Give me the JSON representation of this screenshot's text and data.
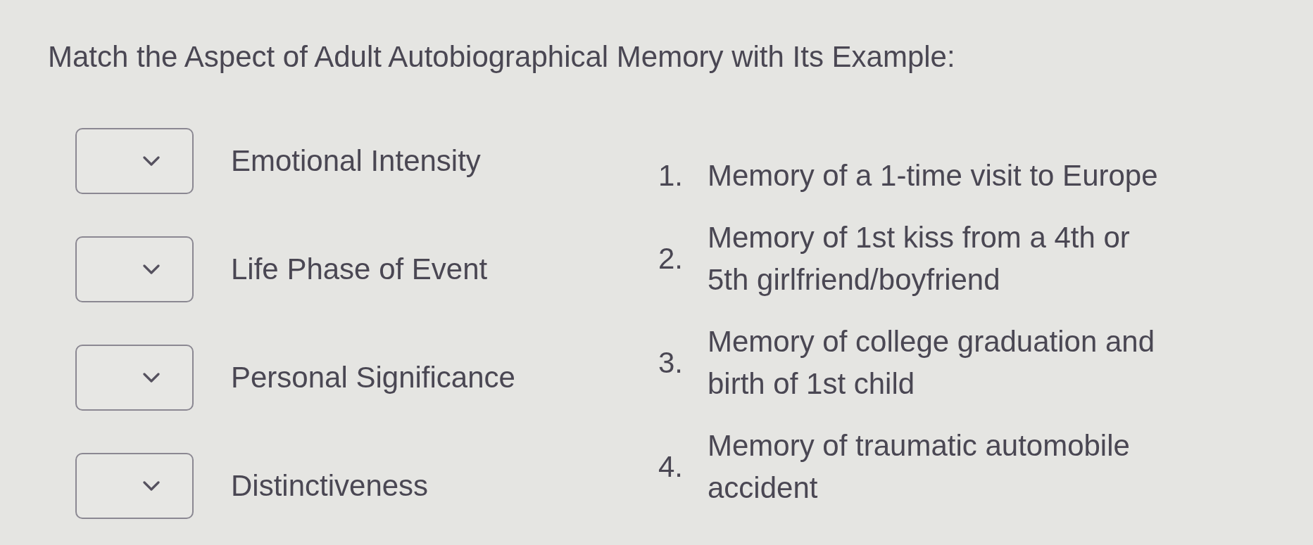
{
  "prompt": "Match the Aspect of Adult Autobiographical Memory with Its Example:",
  "matches": [
    {
      "label": "Emotional Intensity"
    },
    {
      "label": "Life Phase of Event"
    },
    {
      "label": "Personal Significance"
    },
    {
      "label": "Distinctiveness"
    }
  ],
  "examples": [
    {
      "number": "1.",
      "text": "Memory of a 1-time visit to Europe"
    },
    {
      "number": "2.",
      "text": "Memory of 1st kiss from a 4th or 5th girlfriend/boyfriend"
    },
    {
      "number": "3.",
      "text": "Memory of college graduation and birth of 1st child"
    },
    {
      "number": "4.",
      "text": "Memory of traumatic automobile accident"
    }
  ]
}
